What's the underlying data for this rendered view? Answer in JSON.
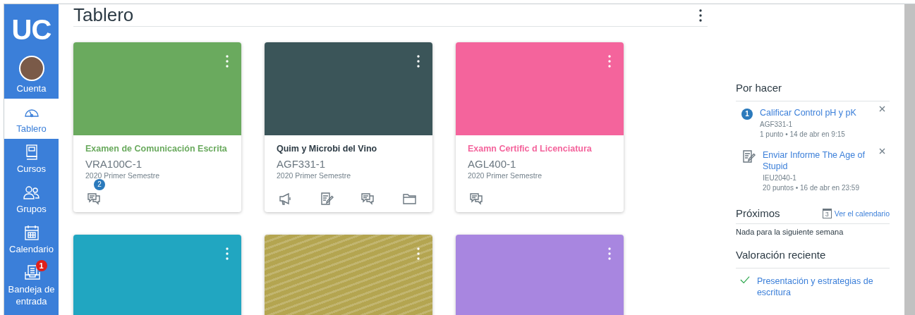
{
  "logo": "UC",
  "nav": [
    {
      "label": "Cuenta",
      "selected": false
    },
    {
      "label": "Tablero",
      "selected": true
    },
    {
      "label": "Cursos",
      "selected": false
    },
    {
      "label": "Grupos",
      "selected": false
    },
    {
      "label": "Calendario",
      "selected": false
    },
    {
      "label": "Bandeja de entrada",
      "selected": false,
      "badge": "1"
    }
  ],
  "header": {
    "title": "Tablero"
  },
  "cards": [
    {
      "kind": "color",
      "color": "#6aaa5e",
      "title": "Examen de Comunicación Escrita",
      "code": "VRA100C-1",
      "term": "2020 Primer Semestre",
      "actions": [
        {
          "kind": "discussion",
          "badge": "2"
        }
      ]
    },
    {
      "kind": "color",
      "color": "#3b5559",
      "title": "Quim y Microbi del Vino",
      "code": "AGF331-1",
      "term": "2020 Primer Semestre",
      "actions": [
        {
          "kind": "announcement"
        },
        {
          "kind": "assignment"
        },
        {
          "kind": "discussion"
        },
        {
          "kind": "folder"
        }
      ]
    },
    {
      "kind": "color",
      "color": "#f4649c",
      "title": "Examn Certific d Licenciatura",
      "code": "AGL400-1",
      "term": "2020 Primer Semestre",
      "actions": [
        {
          "kind": "discussion"
        }
      ]
    },
    {
      "kind": "color",
      "color": "#21a6c1"
    },
    {
      "kind": "photo",
      "color": "#b4a550"
    },
    {
      "kind": "color",
      "color": "#a886e0"
    }
  ],
  "todo": {
    "title": "Por hacer",
    "items": [
      {
        "kind": "number",
        "number": "1",
        "title": "Calificar Control pH y pK",
        "course": "AGF331-1",
        "meta": "1 punto • 14 de abr en 9:15"
      },
      {
        "kind": "assignment",
        "title": "Enviar Informe The Age of Stupid",
        "course": "IEU2040-1",
        "meta": "20 puntos • 16 de abr en 23:59"
      }
    ]
  },
  "upcoming": {
    "title": "Próximos",
    "link": "Ver el calendario",
    "calendar_day": "3",
    "empty": "Nada para la siguiente semana"
  },
  "recent": {
    "title": "Valoración reciente",
    "items": [
      "Presentación y estrategias de escritura"
    ]
  }
}
